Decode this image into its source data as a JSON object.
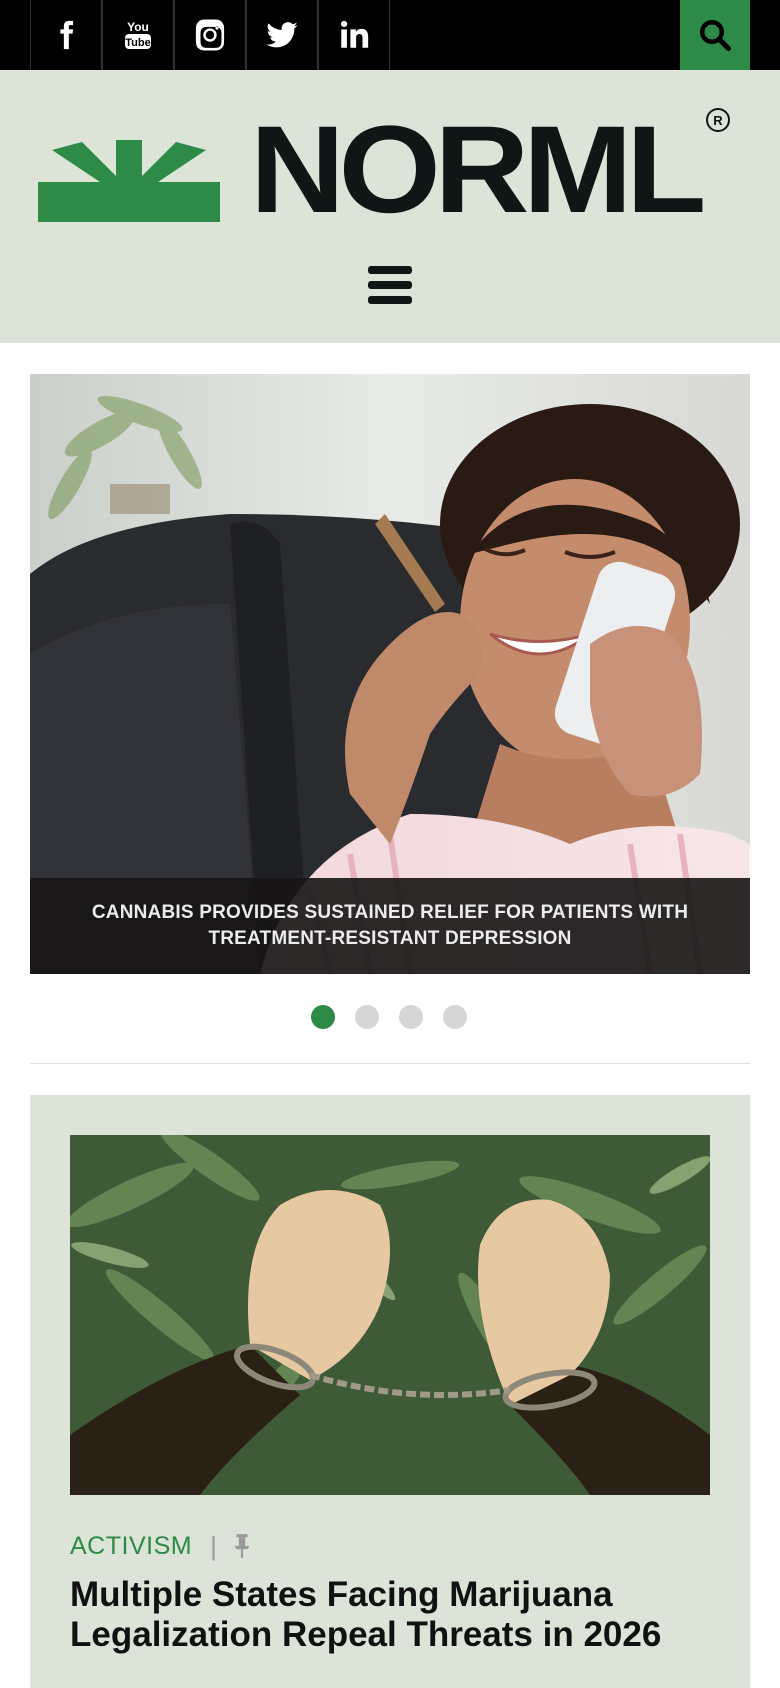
{
  "social": {
    "items": [
      {
        "name": "facebook-icon",
        "label": "f"
      },
      {
        "name": "youtube-icon",
        "label": "YouTube"
      },
      {
        "name": "instagram-icon",
        "label": "Instagram"
      },
      {
        "name": "twitter-icon",
        "label": "Twitter"
      },
      {
        "name": "linkedin-icon",
        "label": "in"
      }
    ]
  },
  "header": {
    "logo_text": "NORML",
    "registered_mark": "R",
    "brand_green": "#2e8b47",
    "brand_dark": "#0e1715",
    "background": "#dce4d8"
  },
  "slider": {
    "caption": "CANNABIS PROVIDES SUSTAINED RELIEF FOR PATIENTS WITH TREATMENT-RESISTANT DEPRESSION",
    "slide_count": 4,
    "active_index": 0
  },
  "article": {
    "category": "ACTIVISM",
    "separator": "|",
    "title": "Multiple States Facing Marijuana Legalization Repeal Threats in 2026"
  }
}
